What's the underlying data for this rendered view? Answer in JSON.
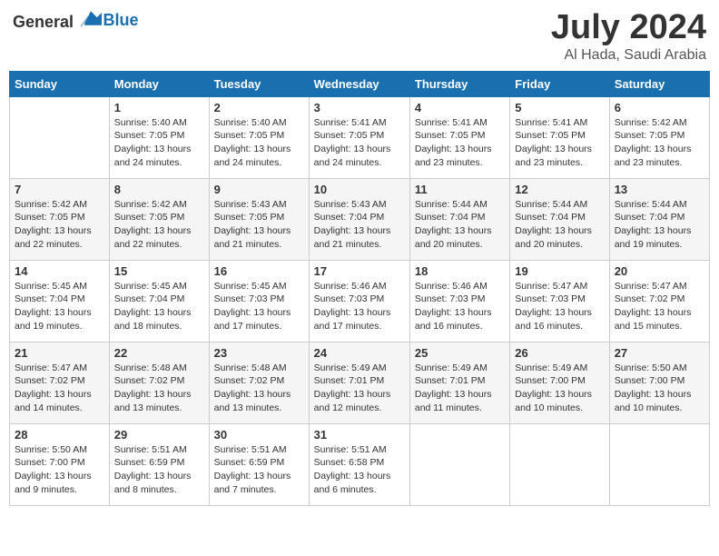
{
  "header": {
    "logo_general": "General",
    "logo_blue": "Blue",
    "month": "July 2024",
    "location": "Al Hada, Saudi Arabia"
  },
  "weekdays": [
    "Sunday",
    "Monday",
    "Tuesday",
    "Wednesday",
    "Thursday",
    "Friday",
    "Saturday"
  ],
  "weeks": [
    [
      {
        "day": "",
        "info": ""
      },
      {
        "day": "1",
        "info": "Sunrise: 5:40 AM\nSunset: 7:05 PM\nDaylight: 13 hours\nand 24 minutes."
      },
      {
        "day": "2",
        "info": "Sunrise: 5:40 AM\nSunset: 7:05 PM\nDaylight: 13 hours\nand 24 minutes."
      },
      {
        "day": "3",
        "info": "Sunrise: 5:41 AM\nSunset: 7:05 PM\nDaylight: 13 hours\nand 24 minutes."
      },
      {
        "day": "4",
        "info": "Sunrise: 5:41 AM\nSunset: 7:05 PM\nDaylight: 13 hours\nand 23 minutes."
      },
      {
        "day": "5",
        "info": "Sunrise: 5:41 AM\nSunset: 7:05 PM\nDaylight: 13 hours\nand 23 minutes."
      },
      {
        "day": "6",
        "info": "Sunrise: 5:42 AM\nSunset: 7:05 PM\nDaylight: 13 hours\nand 23 minutes."
      }
    ],
    [
      {
        "day": "7",
        "info": "Sunrise: 5:42 AM\nSunset: 7:05 PM\nDaylight: 13 hours\nand 22 minutes."
      },
      {
        "day": "8",
        "info": "Sunrise: 5:42 AM\nSunset: 7:05 PM\nDaylight: 13 hours\nand 22 minutes."
      },
      {
        "day": "9",
        "info": "Sunrise: 5:43 AM\nSunset: 7:05 PM\nDaylight: 13 hours\nand 21 minutes."
      },
      {
        "day": "10",
        "info": "Sunrise: 5:43 AM\nSunset: 7:04 PM\nDaylight: 13 hours\nand 21 minutes."
      },
      {
        "day": "11",
        "info": "Sunrise: 5:44 AM\nSunset: 7:04 PM\nDaylight: 13 hours\nand 20 minutes."
      },
      {
        "day": "12",
        "info": "Sunrise: 5:44 AM\nSunset: 7:04 PM\nDaylight: 13 hours\nand 20 minutes."
      },
      {
        "day": "13",
        "info": "Sunrise: 5:44 AM\nSunset: 7:04 PM\nDaylight: 13 hours\nand 19 minutes."
      }
    ],
    [
      {
        "day": "14",
        "info": "Sunrise: 5:45 AM\nSunset: 7:04 PM\nDaylight: 13 hours\nand 19 minutes."
      },
      {
        "day": "15",
        "info": "Sunrise: 5:45 AM\nSunset: 7:04 PM\nDaylight: 13 hours\nand 18 minutes."
      },
      {
        "day": "16",
        "info": "Sunrise: 5:45 AM\nSunset: 7:03 PM\nDaylight: 13 hours\nand 17 minutes."
      },
      {
        "day": "17",
        "info": "Sunrise: 5:46 AM\nSunset: 7:03 PM\nDaylight: 13 hours\nand 17 minutes."
      },
      {
        "day": "18",
        "info": "Sunrise: 5:46 AM\nSunset: 7:03 PM\nDaylight: 13 hours\nand 16 minutes."
      },
      {
        "day": "19",
        "info": "Sunrise: 5:47 AM\nSunset: 7:03 PM\nDaylight: 13 hours\nand 16 minutes."
      },
      {
        "day": "20",
        "info": "Sunrise: 5:47 AM\nSunset: 7:02 PM\nDaylight: 13 hours\nand 15 minutes."
      }
    ],
    [
      {
        "day": "21",
        "info": "Sunrise: 5:47 AM\nSunset: 7:02 PM\nDaylight: 13 hours\nand 14 minutes."
      },
      {
        "day": "22",
        "info": "Sunrise: 5:48 AM\nSunset: 7:02 PM\nDaylight: 13 hours\nand 13 minutes."
      },
      {
        "day": "23",
        "info": "Sunrise: 5:48 AM\nSunset: 7:02 PM\nDaylight: 13 hours\nand 13 minutes."
      },
      {
        "day": "24",
        "info": "Sunrise: 5:49 AM\nSunset: 7:01 PM\nDaylight: 13 hours\nand 12 minutes."
      },
      {
        "day": "25",
        "info": "Sunrise: 5:49 AM\nSunset: 7:01 PM\nDaylight: 13 hours\nand 11 minutes."
      },
      {
        "day": "26",
        "info": "Sunrise: 5:49 AM\nSunset: 7:00 PM\nDaylight: 13 hours\nand 10 minutes."
      },
      {
        "day": "27",
        "info": "Sunrise: 5:50 AM\nSunset: 7:00 PM\nDaylight: 13 hours\nand 10 minutes."
      }
    ],
    [
      {
        "day": "28",
        "info": "Sunrise: 5:50 AM\nSunset: 7:00 PM\nDaylight: 13 hours\nand 9 minutes."
      },
      {
        "day": "29",
        "info": "Sunrise: 5:51 AM\nSunset: 6:59 PM\nDaylight: 13 hours\nand 8 minutes."
      },
      {
        "day": "30",
        "info": "Sunrise: 5:51 AM\nSunset: 6:59 PM\nDaylight: 13 hours\nand 7 minutes."
      },
      {
        "day": "31",
        "info": "Sunrise: 5:51 AM\nSunset: 6:58 PM\nDaylight: 13 hours\nand 6 minutes."
      },
      {
        "day": "",
        "info": ""
      },
      {
        "day": "",
        "info": ""
      },
      {
        "day": "",
        "info": ""
      }
    ]
  ]
}
